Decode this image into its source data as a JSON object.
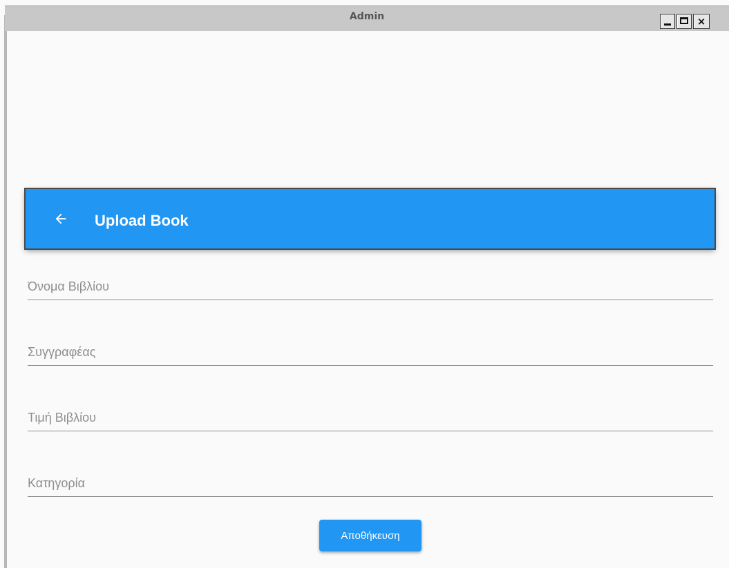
{
  "window": {
    "title": "Admin",
    "close_glyph": "×"
  },
  "appbar": {
    "title": "Upload Book",
    "back_icon": "arrow-left-icon",
    "color": "#2196f3"
  },
  "form": {
    "book_name": {
      "placeholder": "Όνομα Βιβλίου",
      "value": ""
    },
    "author": {
      "placeholder": "Συγγραφέας",
      "value": ""
    },
    "price": {
      "placeholder": "Τιμή Βιβλίου",
      "value": ""
    },
    "category": {
      "placeholder": "Κατηγορία",
      "value": ""
    },
    "save_label": "Αποθήκευση"
  }
}
